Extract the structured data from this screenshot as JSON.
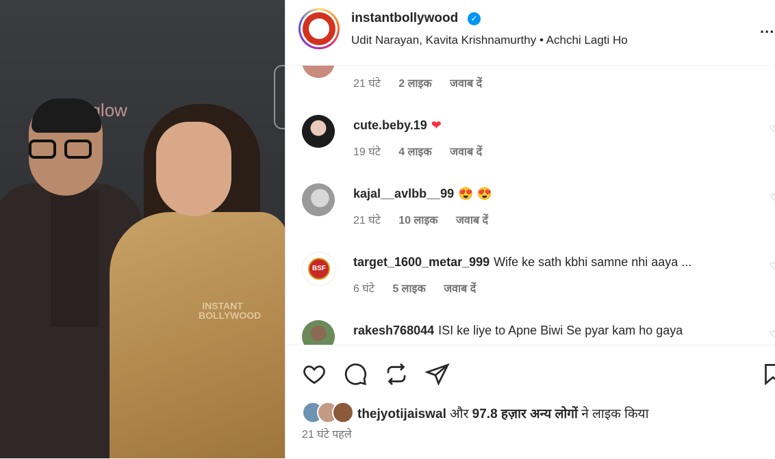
{
  "post": {
    "username": "instantbollywood",
    "verified_icon": "verified-badge-icon",
    "audio": "Udit Narayan, Kavita Krishnamurthy • Achchi Lagti Ho",
    "more_label": "...",
    "media_watermark": "INSTANT BOLLYWOOD",
    "backdrop_text": "nglow"
  },
  "comments": [
    {
      "username": "",
      "text": "",
      "time": "21 घंटे",
      "likes": "2 लाइक",
      "reply": "जवाब दें"
    },
    {
      "username": "cute.beby.19",
      "text": "❤",
      "time": "19 घंटे",
      "likes": "4 लाइक",
      "reply": "जवाब दें"
    },
    {
      "username": "kajal__avlbb__99",
      "text": "😍 😍",
      "time": "21 घंटे",
      "likes": "10 लाइक",
      "reply": "जवाब दें"
    },
    {
      "username": "target_1600_metar_999",
      "text": "Wife ke sath kbhi samne nhi aaya ...",
      "time": "6 घंटे",
      "likes": "5 लाइक",
      "reply": "जवाब दें",
      "avatar_label": "BSF"
    },
    {
      "username": "rakesh768044",
      "text": "ISI ke liye to Apne Biwi Se pyar kam ho gaya"
    }
  ],
  "likes_summary": {
    "liker": "thejyotijaiswal",
    "and": "और",
    "count": "97.8 हज़ार अन्य लोगों",
    "suffix": "ने लाइक किया"
  },
  "time_ago": "21 घंटे पहले",
  "colors": {
    "accent": "#0095f6",
    "text": "#262626",
    "secondary": "#737373",
    "heart": "#ff3040"
  }
}
